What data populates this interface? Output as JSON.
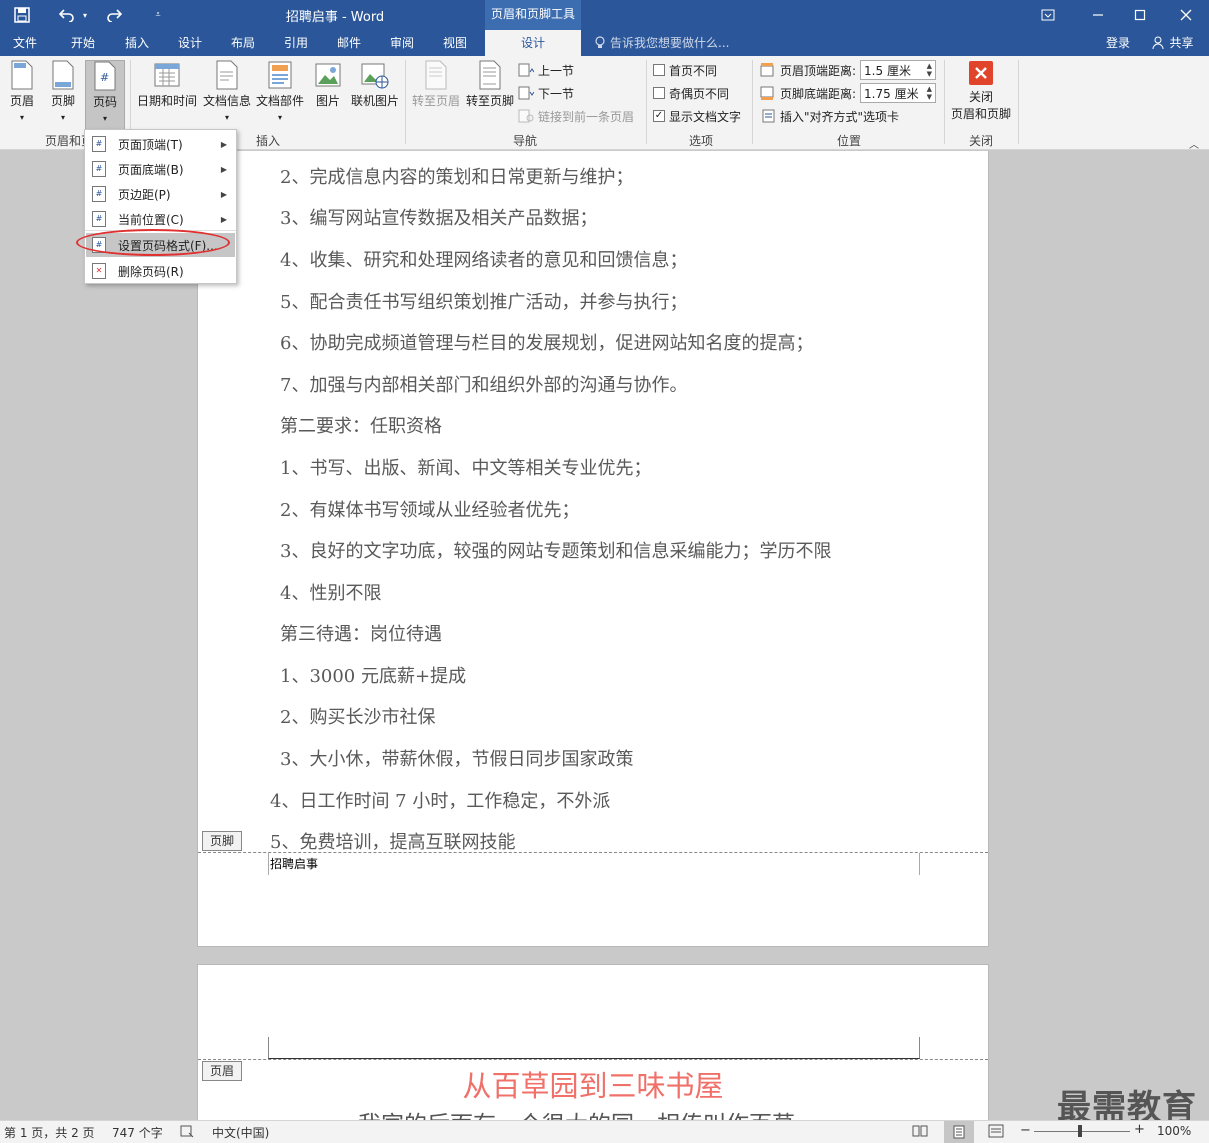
{
  "titlebar": {
    "title": "招聘启事 - Word",
    "context_tab_group": "页眉和页脚工具"
  },
  "tabs": [
    "文件",
    "开始",
    "插入",
    "设计",
    "布局",
    "引用",
    "邮件",
    "审阅",
    "视图"
  ],
  "active_tab": "设计",
  "tell_me": "告诉我您想要做什么...",
  "account": {
    "signin": "登录",
    "share": "共享"
  },
  "ribbon": {
    "hf_group": {
      "header": "页眉",
      "footer": "页脚",
      "page_number": "页码",
      "label": "页眉和页脚"
    },
    "insert_group": {
      "datetime": "日期和时间",
      "docinfo": "文档信息",
      "quickparts": "文档部件",
      "picture": "图片",
      "online_picture": "联机图片",
      "label": "插入"
    },
    "nav_group": {
      "goto_header": "转至页眉",
      "goto_footer": "转至页脚",
      "prev": "上一节",
      "next": "下一节",
      "link_prev": "链接到前一条页眉",
      "label": "导航"
    },
    "options_group": {
      "diff_first": "首页不同",
      "diff_odd_even": "奇偶页不同",
      "show_doc_text": "显示文档文字",
      "label": "选项"
    },
    "position_group": {
      "header_from_top": "页眉顶端距离:",
      "header_value": "1.5 厘米",
      "footer_from_bottom": "页脚底端距离:",
      "footer_value": "1.75 厘米",
      "insert_align_tab": "插入\"对齐方式\"选项卡",
      "label": "位置"
    },
    "close_group": {
      "close_line1": "关闭",
      "close_line2": "页眉和页脚",
      "label": "关闭"
    }
  },
  "dropdown": {
    "items": [
      {
        "label": "页面顶端(T)",
        "submenu": true
      },
      {
        "label": "页面底端(B)",
        "submenu": true
      },
      {
        "label": "页边距(P)",
        "submenu": true
      },
      {
        "label": "当前位置(C)",
        "submenu": true
      },
      {
        "label": "设置页码格式(F)...",
        "submenu": false,
        "highlighted": true
      },
      {
        "label": "删除页码(R)",
        "submenu": false
      }
    ]
  },
  "document": {
    "lines": [
      "2、完成信息内容的策划和日常更新与维护；",
      "3、编写网站宣传数据及相关产品数据；",
      "4、收集、研究和处理网络读者的意见和回馈信息；",
      "5、配合责任书写组织策划推广活动，并参与执行；",
      "6、协助完成频道管理与栏目的发展规划，促进网站知名度的提高；",
      "7、加强与内部相关部门和组织外部的沟通与协作。",
      "第二要求：任职资格",
      "1、书写、出版、新闻、中文等相关专业优先；",
      "2、有媒体书写领域从业经验者优先；",
      "3、良好的文字功底，较强的网站专题策划和信息采编能力；学历不限",
      "4、性别不限",
      "第三待遇：岗位待遇",
      "1、3000 元底薪+提成",
      "2、购买长沙市社保",
      "3、大小休，带薪休假，节假日同步国家政策",
      "4、日工作时间 7 小时，工作稳定，不外派",
      "5、免费培训，提高互联网技能"
    ],
    "footer_tag": "页脚",
    "footer_text": "招聘启事",
    "header_tag": "页眉",
    "page2_title": "从百草园到三味书屋",
    "page2_line": "我家的后面有一个很大的园，相传叫作百草"
  },
  "status": {
    "page": "第 1 页，共 2 页",
    "words": "747 个字",
    "language": "中文(中国)",
    "zoom": "100%"
  },
  "watermark": "最需教育",
  "colors": {
    "brand": "#2b579a",
    "annotation": "#e03030",
    "close_red": "#e0452b"
  }
}
